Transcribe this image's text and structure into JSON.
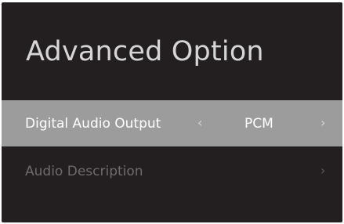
{
  "screen": {
    "title": "Advanced Option"
  },
  "settings": [
    {
      "label": "Digital Audio Output",
      "value": "PCM",
      "selected": true,
      "left_arrow_icon": "chevron-left-icon",
      "right_arrow_icon": "chevron-right-icon"
    },
    {
      "label": "Audio Description",
      "selected": false,
      "right_arrow_icon": "chevron-right-icon"
    }
  ],
  "colors": {
    "background": "#231f20",
    "highlight": "#9c9c9c",
    "title_text": "#d6d6d6",
    "selected_text": "#ffffff",
    "dim_text": "#6d6b6c"
  }
}
